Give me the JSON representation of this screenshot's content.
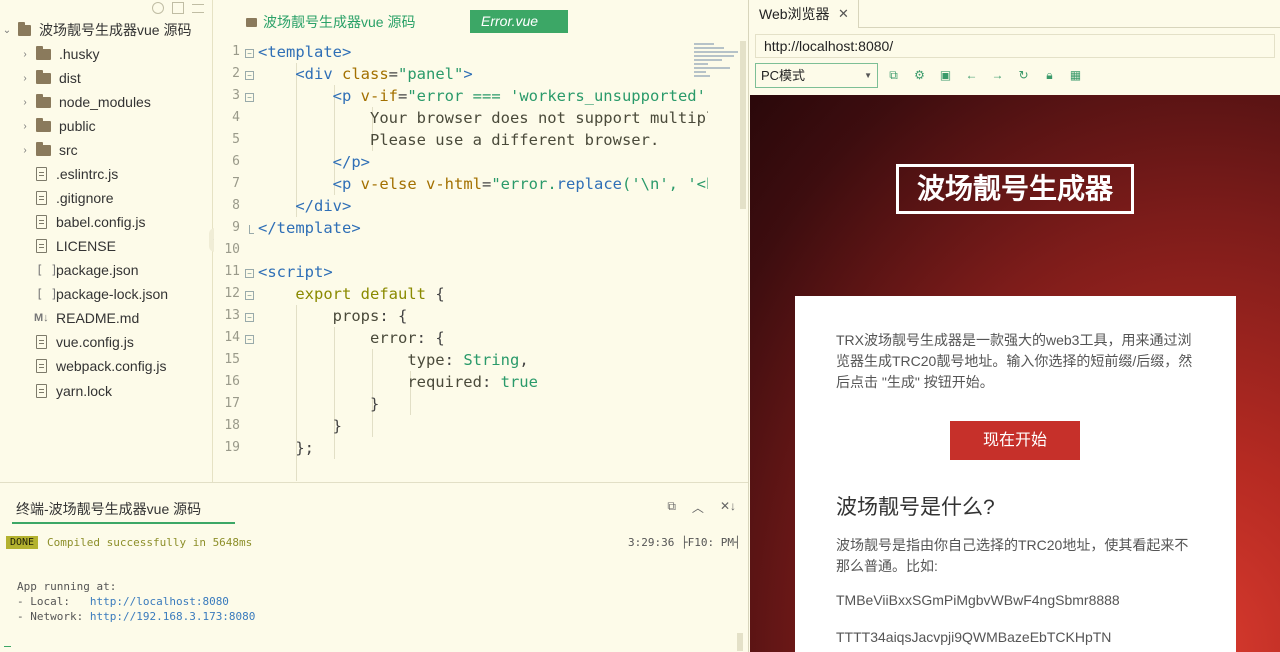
{
  "tree": {
    "root": "波场靓号生成器vue 源码",
    "items": [
      {
        "label": ".husky",
        "kind": "folder"
      },
      {
        "label": "dist",
        "kind": "folder"
      },
      {
        "label": "node_modules",
        "kind": "folder"
      },
      {
        "label": "public",
        "kind": "folder"
      },
      {
        "label": "src",
        "kind": "folder"
      },
      {
        "label": ".eslintrc.js",
        "kind": "file"
      },
      {
        "label": ".gitignore",
        "kind": "file"
      },
      {
        "label": "babel.config.js",
        "kind": "file"
      },
      {
        "label": "LICENSE",
        "kind": "file"
      },
      {
        "label": "package.json",
        "kind": "json"
      },
      {
        "label": "package-lock.json",
        "kind": "json"
      },
      {
        "label": "README.md",
        "kind": "md"
      },
      {
        "label": "vue.config.js",
        "kind": "file"
      },
      {
        "label": "webpack.config.js",
        "kind": "file"
      },
      {
        "label": "yarn.lock",
        "kind": "file"
      }
    ],
    "md_glyph": "M↓",
    "json_glyph": "[ ]"
  },
  "editor": {
    "breadcrumb": "波场靓号生成器vue 源码",
    "active_tab": "Error.vue",
    "line_numbers": [
      "1",
      "2",
      "3",
      "4",
      "5",
      "6",
      "7",
      "8",
      "9",
      "10",
      "11",
      "12",
      "13",
      "14",
      "15",
      "16",
      "17",
      "18",
      "19"
    ]
  },
  "terminal": {
    "title": "终端-波场靓号生成器vue 源码",
    "done_badge": "DONE",
    "compiled": "Compiled successfully in 5648ms",
    "time": "3:29:36 ├F10: PM┤",
    "app_running": "App running at:",
    "local_label": "- Local:   ",
    "local_url": "http://localhost:8080",
    "network_label": "- Network: ",
    "network_url": "http://192.168.3.173:8080"
  },
  "browser": {
    "tab_label": "Web浏览器",
    "tab_close": "✕",
    "url": "http://localhost:8080/",
    "mode": "PC模式",
    "page": {
      "title": "波场靓号生成器",
      "intro": "TRX波场靓号生成器是一款强大的web3工具，用来通过浏览器生成TRC20靓号地址。输入你选择的短前缀/后缀，然后点击 \"生成\" 按钮开始。",
      "start_button": "现在开始",
      "what_title": "波场靓号是什么?",
      "what_desc": "波场靓号是指由你自己选择的TRC20地址，使其看起来不那么普通。比如:",
      "example_1": "TMBeViiBxxSGmPiMgbvWBwF4ngSbmr8888",
      "example_2": "TTTT34aiqsJacvpji9QWMBazeEbTCKHpTN"
    }
  }
}
